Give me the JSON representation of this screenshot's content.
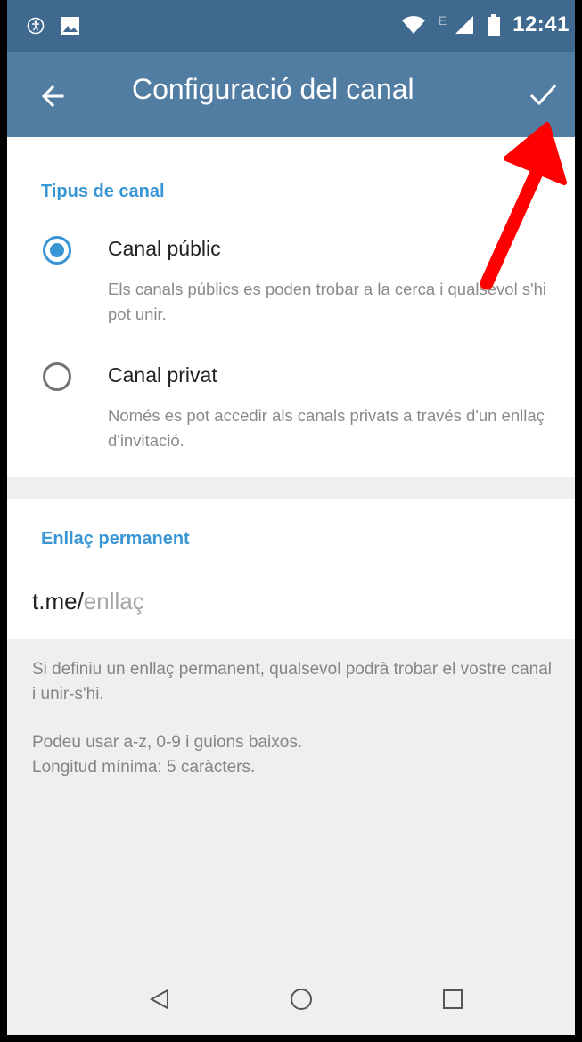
{
  "statusbar": {
    "network_letter": "E",
    "time": "12:41"
  },
  "appbar": {
    "title": "Configuració del canal"
  },
  "channel_type": {
    "section_title": "Tipus de canal",
    "options": [
      {
        "label": "Canal públic",
        "description": "Els canals públics es poden trobar a la cerca i qualsevol s'hi pot unir.",
        "selected": true
      },
      {
        "label": "Canal privat",
        "description": "Només es pot accedir als canals privats a través d'un enllaç d'invitació.",
        "selected": false
      }
    ]
  },
  "permalink": {
    "section_title": "Enllaç permanent",
    "prefix": "t.me/",
    "placeholder": "enllaç",
    "value": ""
  },
  "info": {
    "line1": "Si definiu un enllaç permanent, qualsevol podrà trobar el vostre canal i unir-s'hi.",
    "line2a": "Podeu usar a-z, 0-9 i guions baixos.",
    "line2b": "Longitud mínima: 5 caràcters."
  },
  "colors": {
    "appbar": "#517da2",
    "statusbar": "#40698f",
    "accent": "#3a95d5",
    "annotation_arrow": "#ff0000"
  },
  "icons": {
    "back": "arrow-left-icon",
    "confirm": "checkmark-icon",
    "nav_back": "triangle-back-icon",
    "nav_home": "circle-home-icon",
    "nav_recents": "square-recents-icon"
  }
}
